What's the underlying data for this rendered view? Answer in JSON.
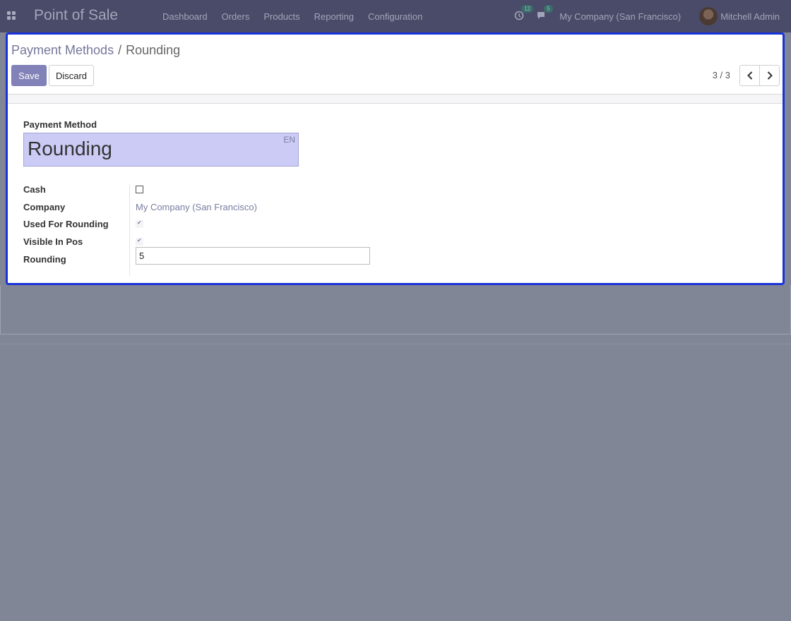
{
  "navbar": {
    "app_name": "Point of Sale",
    "menu": [
      "Dashboard",
      "Orders",
      "Products",
      "Reporting",
      "Configuration"
    ],
    "activity_count": "12",
    "messages_count": "5",
    "company": "My Company (San Francisco)",
    "user": "Mitchell Admin"
  },
  "breadcrumb": {
    "parent": "Payment Methods",
    "separator": "/",
    "current": "Rounding"
  },
  "buttons": {
    "save": "Save",
    "discard": "Discard"
  },
  "pager": {
    "value": "3 / 3"
  },
  "form": {
    "name_label": "Payment Method",
    "name_value": "Rounding",
    "lang": "EN",
    "fields": {
      "cash_label": "Cash",
      "cash_checked": false,
      "company_label": "Company",
      "company_value": "My Company (San Francisco)",
      "used_for_rounding_label": "Used For Rounding",
      "used_for_rounding_checked": true,
      "visible_in_pos_label": "Visible In Pos",
      "visible_in_pos_checked": true,
      "rounding_label": "Rounding",
      "rounding_value": "5"
    }
  },
  "colors": {
    "navbar": "#494b68",
    "primary_button": "#8282b8",
    "focus_border": "#1a33d8",
    "name_field_bg": "#cbcbf5"
  }
}
